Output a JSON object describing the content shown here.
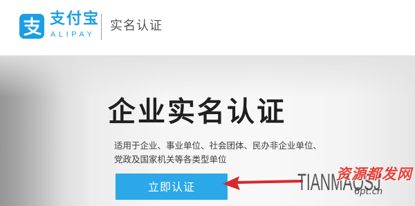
{
  "header": {
    "brand_name": "支付宝",
    "brand_sub": "ALIPAY",
    "logo_icon": "alipay-logo-icon",
    "page_title": "实名认证"
  },
  "banner": {
    "title": "企业实名认证",
    "description_lines": [
      "适用于企业、事业单位、社会团体、民办非企业单位、",
      "党政及国家机关等各类型单位"
    ],
    "button_label": "立即认证",
    "arrow_icon": "red-arrow-left-icon"
  },
  "watermark": {
    "latin": "TIANMAOSJ",
    "chinese": "资源都发网",
    "url": "6pt.cn"
  },
  "colors": {
    "brand_blue": "#1a9fe6",
    "button_blue": "#2aa8e8",
    "arrow_red": "#d8282d",
    "watermark_red": "#e8423a"
  }
}
